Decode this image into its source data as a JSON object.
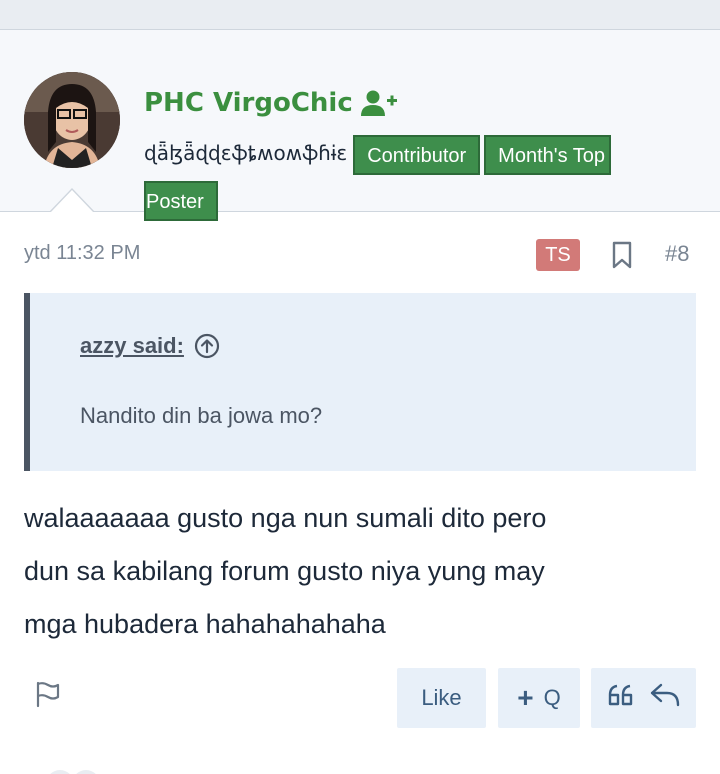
{
  "post": {
    "username": "PHC VirgoChic",
    "user_title": "ɖǟɮǟɖɖɛֆȶʍօʍֆɦɨɛ",
    "badges": [
      "Contributor",
      "Month's Top",
      "Poster"
    ],
    "date": "ytd 11:32 PM",
    "ts_label": "TS",
    "post_number": "#8",
    "quote": {
      "author": "azzy said:",
      "text": "Nandito din ba jowa mo?"
    },
    "body_lines": [
      "walaaaaaaa gusto nga nun sumali dito pero",
      "dun sa kabilang forum gusto niya yung may",
      "mga hubadera hahahahahaha"
    ],
    "actions": {
      "like": "Like",
      "multiquote_plus": "+",
      "multiquote": "Q"
    }
  },
  "icons": {
    "follow": "user-plus-icon",
    "bookmark": "bookmark-icon",
    "quote_jump": "arrow-up-circle-icon",
    "report": "flag-icon",
    "quote": "quote-icon",
    "reply": "reply-icon"
  },
  "colors": {
    "username": "#3b8f3f",
    "badge_bg": "#3e8e4c",
    "ts_bg": "#d27a78",
    "quote_bg": "#e8f0f9",
    "button_bg": "#e8f0f9"
  }
}
